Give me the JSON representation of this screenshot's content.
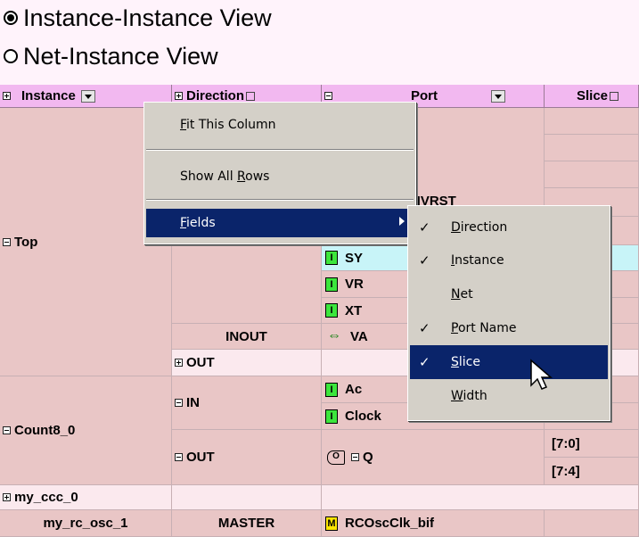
{
  "view_options": [
    {
      "label": "Instance-Instance View",
      "selected": true
    },
    {
      "label": "Net-Instance View",
      "selected": false
    }
  ],
  "columns": [
    "Instance",
    "Direction",
    "Port",
    "Slice"
  ],
  "rows": {
    "top": "Top",
    "inout": "INOUT",
    "out": "OUT",
    "count8": "Count8_0",
    "in": "IN",
    "out2": "OUT",
    "my_ccc": "my_ccc_0",
    "my_rc": "my_rc_osc_1",
    "master": "MASTER"
  },
  "ports": {
    "p_nvrst": "NVRST",
    "p_sy": "SY",
    "p_vr": "VR",
    "p_xt": "XT",
    "p_va": "VA",
    "p_ac": "Ac",
    "p_clock": "Clock",
    "p_q": "Q",
    "p_rcosc": "RCOscClk_bif"
  },
  "pin_labels": {
    "input": "I",
    "output": "O",
    "master": "M",
    "bidir": "⇔"
  },
  "slices": {
    "s1": "[7:0]",
    "s2": "[7:4]"
  },
  "context_menu": {
    "fit_this_column": "Fit This Column",
    "show_all_rows": "Show All Rows",
    "fields": "Fields"
  },
  "fields_submenu": [
    {
      "label": "Direction",
      "checked": true
    },
    {
      "label": "Instance",
      "checked": true
    },
    {
      "label": "Net",
      "checked": false
    },
    {
      "label": "Port Name",
      "checked": true
    },
    {
      "label": "Slice",
      "checked": true,
      "highlighted": true
    },
    {
      "label": "Width",
      "checked": false
    }
  ],
  "check_glyph": "✓"
}
